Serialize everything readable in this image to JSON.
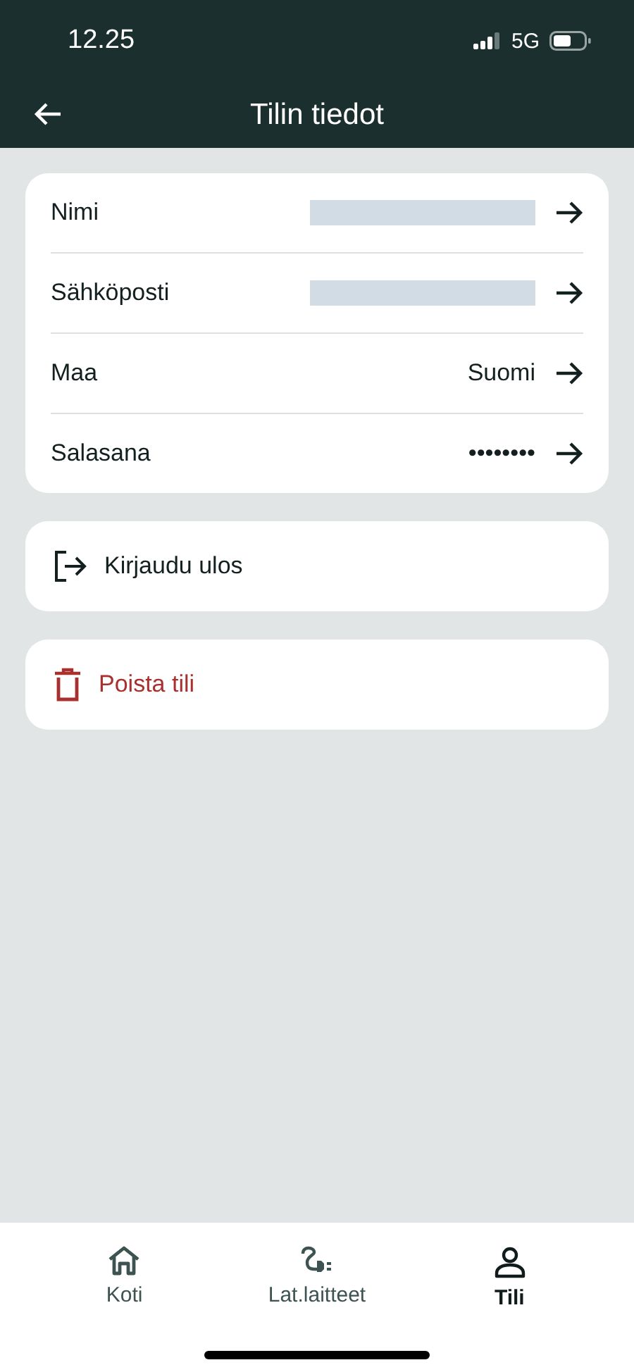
{
  "status_bar": {
    "time": "12.25",
    "network": "5G"
  },
  "header": {
    "title": "Tilin tiedot"
  },
  "fields": [
    {
      "label": "Nimi",
      "kind": "redacted"
    },
    {
      "label": "Sähköposti",
      "kind": "redacted"
    },
    {
      "label": "Maa",
      "kind": "text",
      "value": "Suomi"
    },
    {
      "label": "Salasana",
      "kind": "text",
      "value": "••••••••"
    }
  ],
  "actions": [
    {
      "label": "Kirjaudu ulos",
      "kind": "logout"
    },
    {
      "label": "Poista tili",
      "kind": "delete"
    }
  ],
  "tabs": [
    {
      "label": "Koti",
      "kind": "home",
      "selected": false
    },
    {
      "label": "Lat.laitteet",
      "kind": "plug",
      "selected": false
    },
    {
      "label": "Tili",
      "kind": "person",
      "selected": true
    }
  ]
}
